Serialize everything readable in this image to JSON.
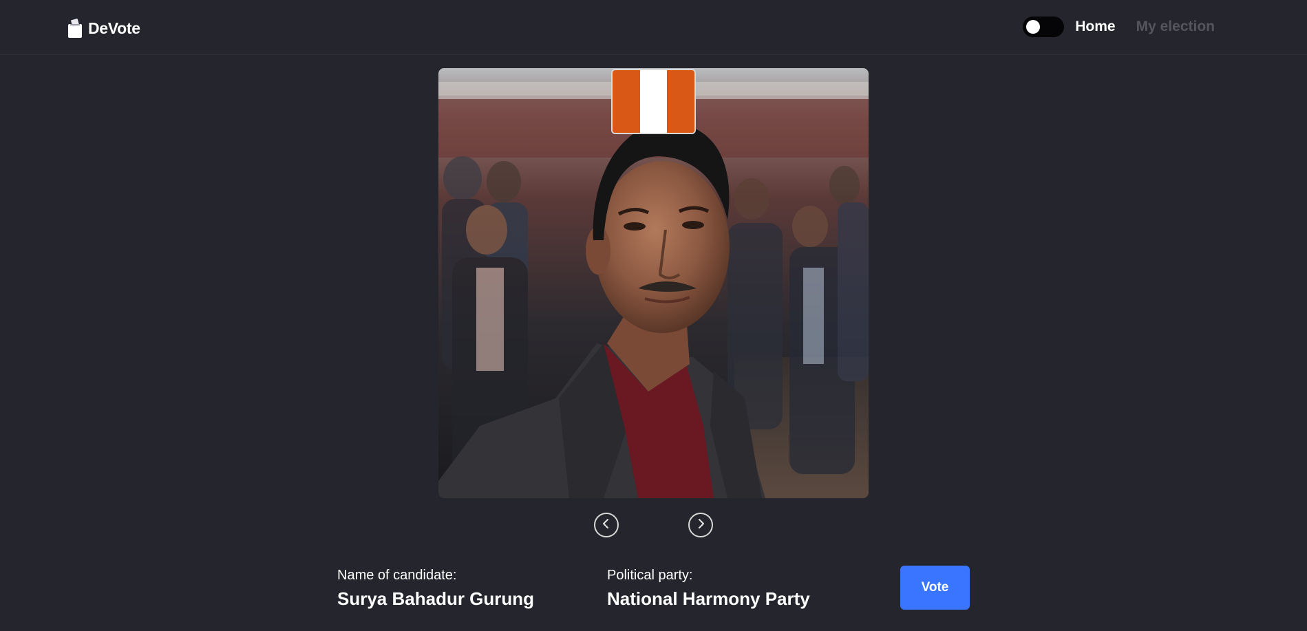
{
  "app": {
    "brand_name": "DeVote"
  },
  "nav": {
    "home_label": "Home",
    "my_election_label": "My election",
    "theme_toggle_state": "off"
  },
  "candidate": {
    "name_label": "Name of candidate:",
    "name_value": "Surya Bahadur Gurung",
    "party_label": "Political party:",
    "party_value": "National Harmony Party",
    "party_flag_colors": [
      "#d95816",
      "#ffffff",
      "#d95816"
    ]
  },
  "actions": {
    "vote_label": "Vote"
  },
  "icons": {
    "brand": "ballot-box-icon",
    "prev": "chevron-left-icon",
    "next": "chevron-right-icon"
  },
  "colors": {
    "background": "#25262d",
    "accent": "#3a75ff",
    "muted_text": "#55565d"
  }
}
